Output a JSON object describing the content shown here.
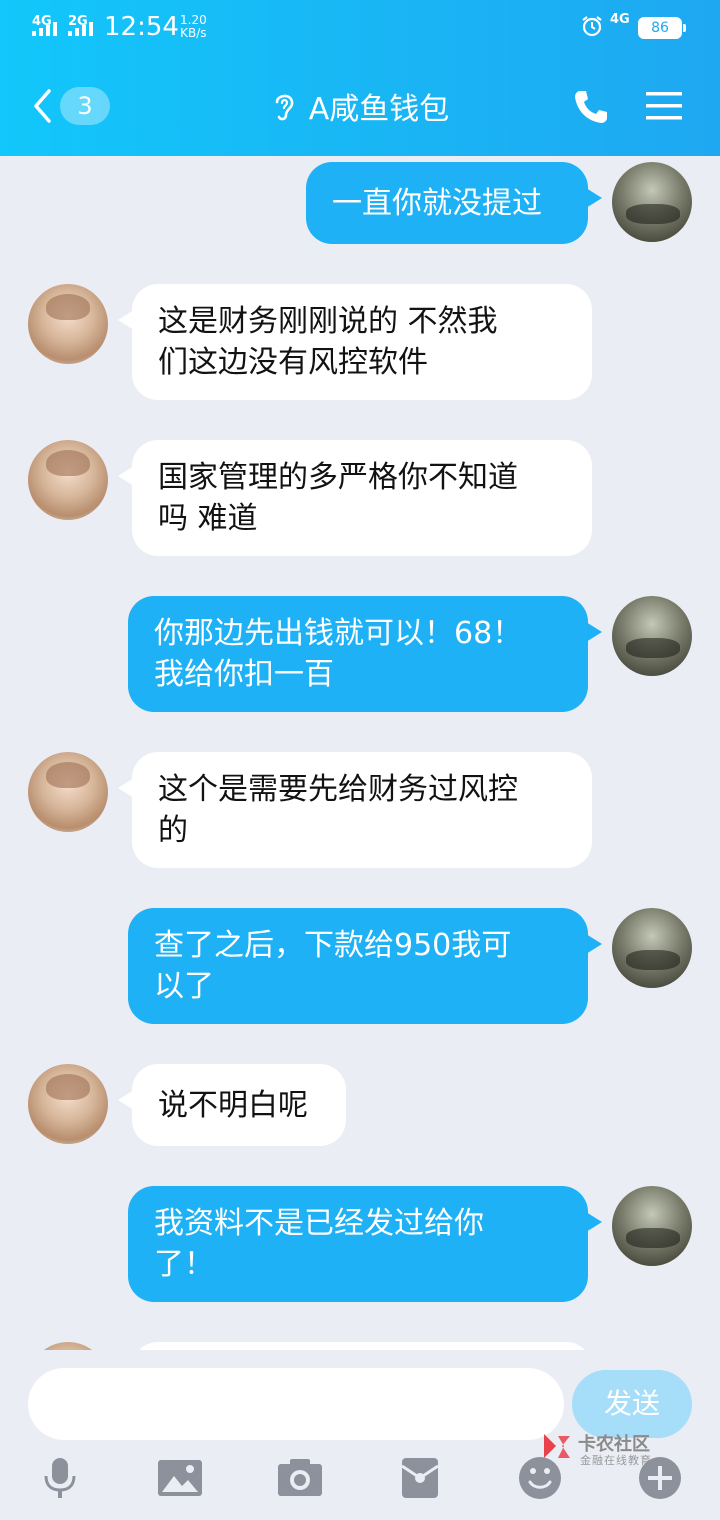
{
  "status_bar": {
    "signal1": "4G",
    "signal2": "2G",
    "time": "12:54",
    "speed_value": "1.20",
    "speed_unit": "KB/s",
    "network": "4G",
    "battery": "86"
  },
  "header": {
    "unread_count": "3",
    "title": "A咸鱼钱包",
    "icons": [
      "back-chevron-icon",
      "ear-icon",
      "phone-icon",
      "menu-icon"
    ]
  },
  "messages": [
    {
      "from": "me",
      "text": "一直你就没提过"
    },
    {
      "from": "them",
      "text": "这是财务刚刚说的  不然我\n们这边没有风控软件"
    },
    {
      "from": "them",
      "text": "国家管理的多严格你不知道\n吗 难道"
    },
    {
      "from": "me",
      "text": "你那边先出钱就可以！68！\n我给你扣一百"
    },
    {
      "from": "them",
      "text": "这个是需要先给财务过风控\n的"
    },
    {
      "from": "me",
      "text": "查了之后，下款给950我可\n以了"
    },
    {
      "from": "them",
      "text": "说不明白呢"
    },
    {
      "from": "me",
      "text": "我资料不是已经发过给你\n了！"
    }
  ],
  "input": {
    "value": "",
    "send_label": "发送"
  },
  "toolbar_icons": [
    "microphone-icon",
    "image-icon",
    "camera-icon",
    "red-packet-icon",
    "emoji-icon",
    "plus-icon"
  ],
  "watermark": {
    "title": "卡农社区",
    "subtitle": "金融在线教育"
  },
  "colors": {
    "header_gradient_start": "#12c7fb",
    "header_gradient_end": "#1ea8f1",
    "my_bubble": "#1eb1f6",
    "their_bubble": "#ffffff",
    "background": "#ebedf5",
    "send_button": "#a6ddf9"
  }
}
